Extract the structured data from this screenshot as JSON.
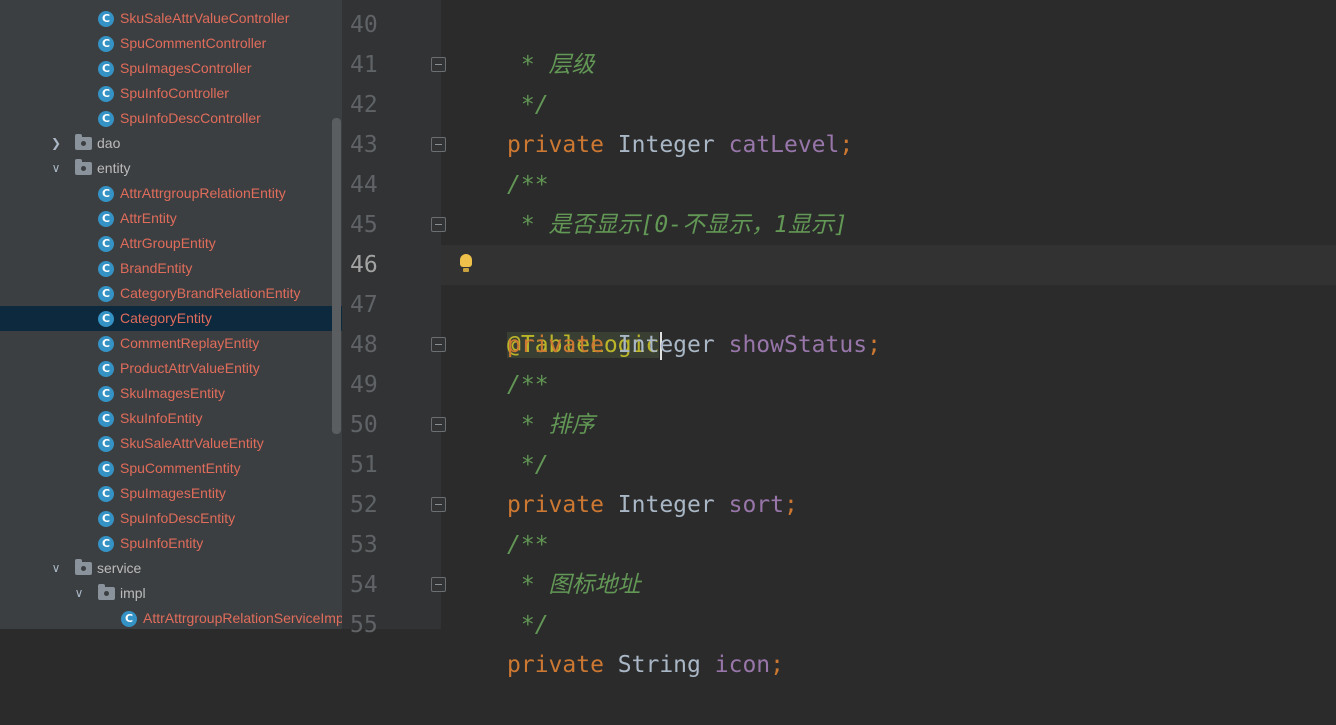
{
  "project_tree": {
    "controllers": [
      "SkuSaleAttrValueController",
      "SpuCommentController",
      "SpuImagesController",
      "SpuInfoController",
      "SpuInfoDescController"
    ],
    "folders": {
      "dao": "dao",
      "entity": "entity",
      "service": "service",
      "impl": "impl"
    },
    "entities": [
      "AttrAttrgroupRelationEntity",
      "AttrEntity",
      "AttrGroupEntity",
      "BrandEntity",
      "CategoryBrandRelationEntity",
      "CategoryEntity",
      "CommentReplayEntity",
      "ProductAttrValueEntity",
      "SkuImagesEntity",
      "SkuInfoEntity",
      "SkuSaleAttrValueEntity",
      "SpuCommentEntity",
      "SpuImagesEntity",
      "SpuInfoDescEntity",
      "SpuInfoEntity"
    ],
    "selected_item": "CategoryEntity",
    "impl_items": [
      "AttrAttrgroupRelationServiceImpl"
    ],
    "class_icon_letter": "C"
  },
  "editor": {
    "current_line": 46,
    "line_numbers": [
      "40",
      "41",
      "42",
      "43",
      "44",
      "45",
      "46",
      "47",
      "48",
      "49",
      "50",
      "51",
      "52",
      "53",
      "54",
      "55"
    ],
    "lines": {
      "l40": " * 层级",
      "l41": " */",
      "l42": {
        "kw": "private",
        "type": "Integer",
        "field": "catLevel",
        "end": ";"
      },
      "l43": "/**",
      "l44": " * 是否显示[0-不显示，1显示]",
      "l45": " */",
      "l46": "@TableLogic",
      "l47": {
        "kw": "private",
        "type": "Integer",
        "field": "showStatus",
        "end": ";"
      },
      "l48": "/**",
      "l49": " * 排序",
      "l50": " */",
      "l51": {
        "kw": "private",
        "type": "Integer",
        "field": "sort",
        "end": ";"
      },
      "l52": "/**",
      "l53": " * 图标地址",
      "l54": " */",
      "l55": {
        "kw": "private",
        "type": "String",
        "field": "icon",
        "end": ";"
      }
    }
  },
  "colors": {
    "keyword": "#cc7832",
    "field": "#9876aa",
    "comment": "#629755",
    "annotation": "#bbb529",
    "class_label": "#e06c5b",
    "class_icon": "#3592c4",
    "selection": "#0d293e"
  },
  "icons": {
    "class": "class-c-icon",
    "folder": "package-folder-icon",
    "expanded": "chevron-down-icon",
    "collapsed": "chevron-right-icon",
    "intention": "lightbulb-icon"
  }
}
